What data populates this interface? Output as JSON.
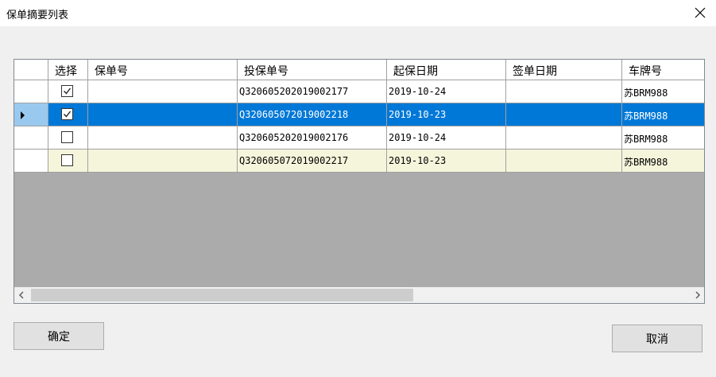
{
  "window": {
    "title": "保单摘要列表"
  },
  "grid": {
    "columns": [
      "选择",
      "保单号",
      "投保单号",
      "起保日期",
      "签单日期",
      "车牌号"
    ],
    "rows": [
      {
        "checked": true,
        "policy_no": "",
        "application_no": "Q320605202019002177",
        "start_date": "2019-10-24",
        "sign_date": "",
        "plate": "苏BRM988"
      },
      {
        "checked": true,
        "policy_no": "",
        "application_no": "Q320605072019002218",
        "start_date": "2019-10-23",
        "sign_date": "",
        "plate": "苏BRM988"
      },
      {
        "checked": false,
        "policy_no": "",
        "application_no": "Q320605202019002176",
        "start_date": "2019-10-24",
        "sign_date": "",
        "plate": "苏BRM988"
      },
      {
        "checked": false,
        "policy_no": "",
        "application_no": "Q320605072019002217",
        "start_date": "2019-10-23",
        "sign_date": "",
        "plate": "苏BRM988"
      }
    ],
    "selected_row": 1
  },
  "buttons": {
    "ok": "确定",
    "cancel": "取消"
  },
  "icons": {
    "close": "close-icon",
    "scroll_left": "chevron-left-icon",
    "scroll_right": "chevron-right-icon",
    "current_row": "row-pointer-icon"
  },
  "colors": {
    "selection": "#0078d7",
    "alt_row": "#f5f5dc",
    "grid_bg": "#ababab"
  }
}
